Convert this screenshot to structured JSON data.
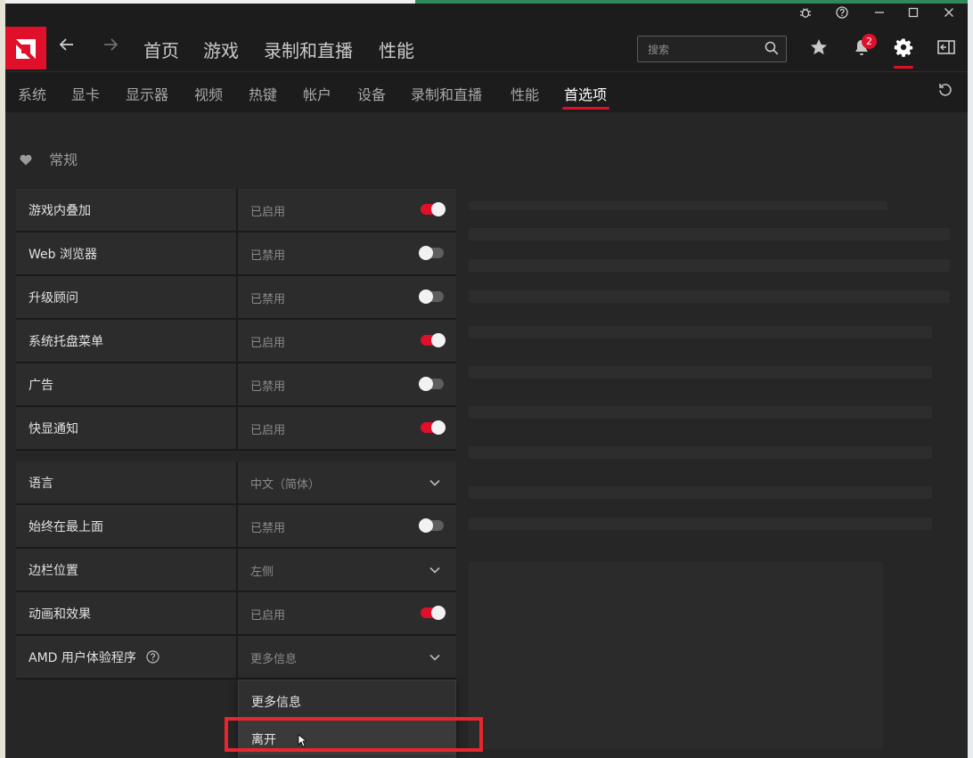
{
  "colors": {
    "accent": "#e0102a",
    "annotation_box": "#e8262e"
  },
  "window_controls": [
    "bug-icon",
    "help-icon",
    "minimize-icon",
    "maximize-icon",
    "close-icon"
  ],
  "main_nav": {
    "items": [
      "首页",
      "游戏",
      "录制和直播",
      "性能"
    ],
    "search_placeholder": "搜索",
    "notification_count": "2"
  },
  "sub_nav": {
    "items": [
      "系统",
      "显卡",
      "显示器",
      "视频",
      "热键",
      "帐户",
      "设备",
      "录制和直播",
      "性能",
      "首选项"
    ],
    "active": "首选项"
  },
  "section": {
    "title": "常规"
  },
  "group1": [
    {
      "label": "游戏内叠加",
      "value": "已启用",
      "control": "toggle",
      "on": true
    },
    {
      "label": "Web 浏览器",
      "value": "已禁用",
      "control": "toggle",
      "on": false
    },
    {
      "label": "升级顾问",
      "value": "已禁用",
      "control": "toggle",
      "on": false
    },
    {
      "label": "系统托盘菜单",
      "value": "已启用",
      "control": "toggle",
      "on": true
    },
    {
      "label": "广告",
      "value": "已禁用",
      "control": "toggle",
      "on": false
    },
    {
      "label": "快显通知",
      "value": "已启用",
      "control": "toggle",
      "on": true
    }
  ],
  "group2": [
    {
      "label": "语言",
      "value": "中文（简体）",
      "control": "dropdown"
    },
    {
      "label": "始终在最上面",
      "value": "已禁用",
      "control": "toggle",
      "on": false
    },
    {
      "label": "边栏位置",
      "value": "左侧",
      "control": "dropdown"
    },
    {
      "label": "动画和效果",
      "value": "已启用",
      "control": "toggle",
      "on": true
    },
    {
      "label": "AMD 用户体验程序",
      "value": "更多信息",
      "control": "dropdown"
    }
  ],
  "dropdown_options": [
    "更多信息",
    "离开"
  ],
  "dropdown_hovered": "离开"
}
